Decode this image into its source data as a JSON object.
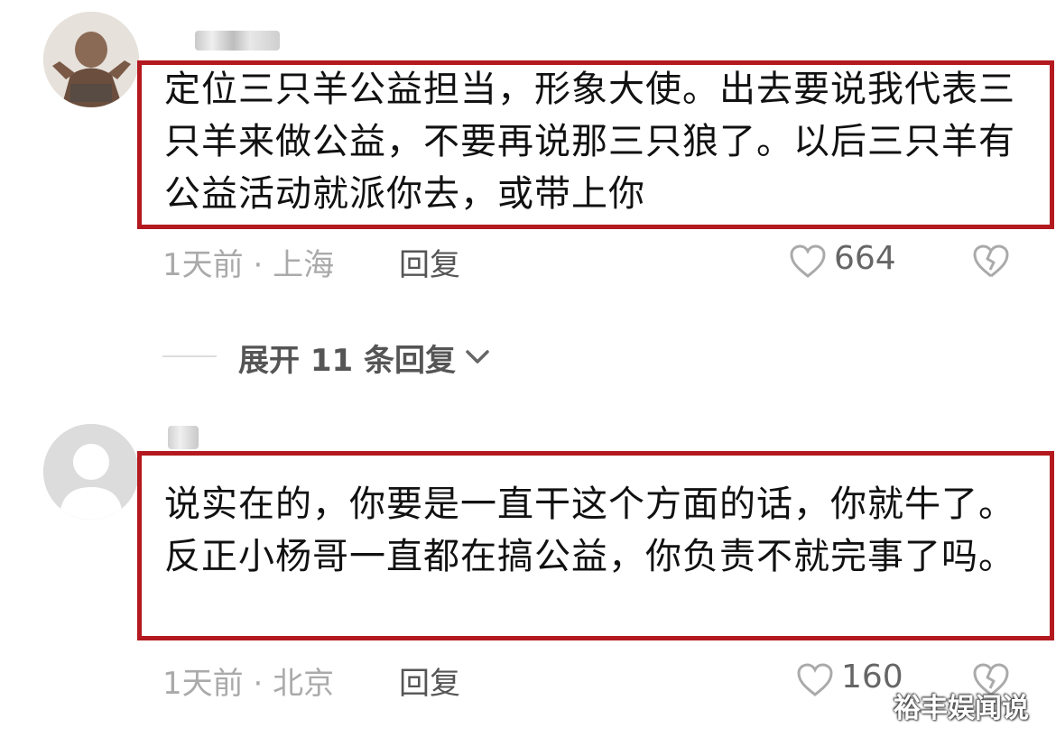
{
  "comments": [
    {
      "text": "定位三只羊公益担当，形象大使。出去要说我代表三只羊来做公益，不要再说那三只狼了。以后三只羊有公益活动就派你去，或带上你",
      "time": "1天前",
      "location": "上海",
      "meta_separator": " · ",
      "reply_label": "回复",
      "likes": "664"
    },
    {
      "text": "说实在的，你要是一直干这个方面的话，你就牛了。反正小杨哥一直都在搞公益，你负责不就完事了吗。",
      "time": "1天前",
      "location": "北京",
      "meta_separator": " · ",
      "reply_label": "回复",
      "likes": "160"
    }
  ],
  "expand_replies": {
    "label": "展开 11 条回复"
  },
  "watermark": "裕丰娱闻说",
  "colors": {
    "highlight_border": "#b3191f",
    "meta_text": "#aaaaaa",
    "body_text": "#111111"
  },
  "icons": {
    "like": "heart-outline-icon",
    "dislike": "broken-heart-icon",
    "expand": "chevron-down-icon",
    "default_avatar": "default-user-avatar-icon"
  }
}
